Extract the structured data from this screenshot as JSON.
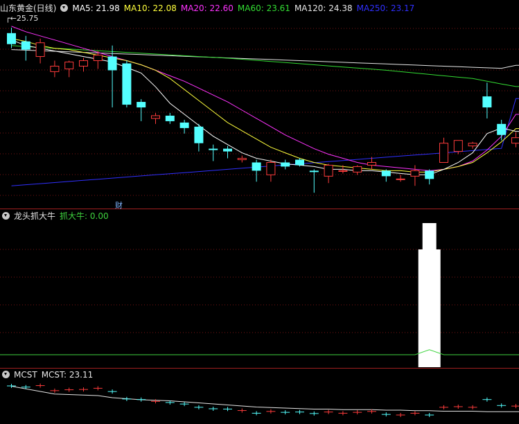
{
  "main_panel": {
    "title": "山东黄金(日线)",
    "ma": [
      {
        "label": "MA5: 21.98",
        "color": "#ffffff"
      },
      {
        "label": "MA10: 22.08",
        "color": "#ffff3c"
      },
      {
        "label": "MA20: 22.60",
        "color": "#ff33ff"
      },
      {
        "label": "MA60: 23.61",
        "color": "#33dd33"
      },
      {
        "label": "MA120: 24.38",
        "color": "#e6e6e6"
      },
      {
        "label": "MA250: 23.17",
        "color": "#3030ff"
      }
    ],
    "high_marker": "25.75",
    "event_marker": "财"
  },
  "sub_panel1": {
    "title": "龙头抓大牛",
    "series_label": "抓大牛: 0.00"
  },
  "sub_panel2": {
    "title": "MCST",
    "value_label": "MCST: 23.11"
  },
  "colors": {
    "up": "#ff3c3c",
    "down": "#54ffff",
    "grid": "#7a1515",
    "ma5": "#ffffff",
    "ma10": "#ffff3c",
    "ma20": "#ff33ff",
    "ma60": "#33dd33",
    "ma120": "#e6e6e6",
    "ma250": "#3030ff",
    "signal_bar": "#ffffff",
    "signal_line": "#3fd43f"
  },
  "chart_data": {
    "type": "candlestick",
    "candles": [
      {
        "o": 25.55,
        "h": 25.75,
        "l": 25.0,
        "c": 25.15
      },
      {
        "o": 25.25,
        "h": 25.45,
        "l": 24.55,
        "c": 24.95
      },
      {
        "o": 24.7,
        "h": 25.35,
        "l": 24.45,
        "c": 25.2
      },
      {
        "o": 24.15,
        "h": 24.55,
        "l": 23.95,
        "c": 24.35
      },
      {
        "o": 24.25,
        "h": 24.55,
        "l": 23.95,
        "c": 24.5
      },
      {
        "o": 24.35,
        "h": 24.65,
        "l": 24.15,
        "c": 24.55
      },
      {
        "o": 24.55,
        "h": 24.9,
        "l": 24.25,
        "c": 24.75
      },
      {
        "o": 24.7,
        "h": 25.1,
        "l": 22.85,
        "c": 24.2
      },
      {
        "o": 24.45,
        "h": 24.55,
        "l": 22.85,
        "c": 22.95
      },
      {
        "o": 23.05,
        "h": 23.15,
        "l": 22.35,
        "c": 22.85
      },
      {
        "o": 22.45,
        "h": 22.65,
        "l": 22.25,
        "c": 22.55
      },
      {
        "o": 22.55,
        "h": 22.65,
        "l": 22.25,
        "c": 22.35
      },
      {
        "o": 22.3,
        "h": 22.4,
        "l": 21.9,
        "c": 22.1
      },
      {
        "o": 22.15,
        "h": 22.25,
        "l": 21.25,
        "c": 21.55
      },
      {
        "o": 21.35,
        "h": 21.5,
        "l": 20.9,
        "c": 21.3
      },
      {
        "o": 21.35,
        "h": 21.45,
        "l": 21.0,
        "c": 21.25
      },
      {
        "o": 20.95,
        "h": 21.1,
        "l": 20.85,
        "c": 21.0
      },
      {
        "o": 20.85,
        "h": 20.95,
        "l": 20.15,
        "c": 20.55
      },
      {
        "o": 20.4,
        "h": 20.95,
        "l": 20.15,
        "c": 20.85
      },
      {
        "o": 20.85,
        "h": 20.95,
        "l": 20.6,
        "c": 20.7
      },
      {
        "o": 20.95,
        "h": 21.0,
        "l": 20.7,
        "c": 20.75
      },
      {
        "o": 20.55,
        "h": 20.6,
        "l": 19.75,
        "c": 20.5
      },
      {
        "o": 20.35,
        "h": 20.8,
        "l": 20.1,
        "c": 20.75
      },
      {
        "o": 20.55,
        "h": 20.75,
        "l": 20.45,
        "c": 20.55
      },
      {
        "o": 20.5,
        "h": 20.75,
        "l": 20.4,
        "c": 20.7
      },
      {
        "o": 20.75,
        "h": 21.05,
        "l": 20.6,
        "c": 20.85
      },
      {
        "o": 20.55,
        "h": 20.6,
        "l": 20.15,
        "c": 20.35
      },
      {
        "o": 20.25,
        "h": 20.4,
        "l": 20.15,
        "c": 20.25
      },
      {
        "o": 20.35,
        "h": 20.75,
        "l": 20.0,
        "c": 20.55
      },
      {
        "o": 20.55,
        "h": 20.6,
        "l": 20.05,
        "c": 20.25
      },
      {
        "o": 20.85,
        "h": 21.75,
        "l": 20.85,
        "c": 21.55
      },
      {
        "o": 21.25,
        "h": 21.65,
        "l": 21.15,
        "c": 21.65
      },
      {
        "o": 21.45,
        "h": 21.6,
        "l": 21.35,
        "c": 21.55
      },
      {
        "o": 23.25,
        "h": 23.75,
        "l": 22.45,
        "c": 22.85
      },
      {
        "o": 22.25,
        "h": 22.4,
        "l": 21.65,
        "c": 21.85
      },
      {
        "o": 21.55,
        "h": 21.95,
        "l": 21.4,
        "c": 21.75
      }
    ],
    "ma5": [
      25.3,
      25.1,
      25.0,
      24.9,
      24.8,
      24.7,
      24.6,
      24.5,
      24.3,
      24.1,
      23.6,
      23.0,
      22.6,
      22.2,
      21.8,
      21.5,
      21.2,
      21.0,
      20.9,
      20.8,
      20.75,
      20.7,
      20.6,
      20.6,
      20.55,
      20.55,
      20.5,
      20.45,
      20.4,
      20.4,
      20.6,
      20.85,
      21.2,
      21.9,
      22.1,
      21.98
    ],
    "ma10": [
      25.35,
      25.25,
      25.1,
      25.0,
      24.95,
      24.85,
      24.75,
      24.65,
      24.55,
      24.4,
      24.2,
      23.9,
      23.5,
      23.1,
      22.7,
      22.3,
      22.0,
      21.7,
      21.4,
      21.2,
      21.0,
      20.85,
      20.75,
      20.7,
      20.65,
      20.6,
      20.55,
      20.55,
      20.5,
      20.5,
      20.6,
      20.7,
      20.85,
      21.2,
      21.6,
      22.08
    ],
    "ma20": [
      25.8,
      25.6,
      25.45,
      25.3,
      25.15,
      25.0,
      24.85,
      24.7,
      24.55,
      24.4,
      24.2,
      24.0,
      23.8,
      23.55,
      23.3,
      23.05,
      22.75,
      22.45,
      22.15,
      21.85,
      21.6,
      21.35,
      21.15,
      21.0,
      20.85,
      20.75,
      20.7,
      20.65,
      20.6,
      20.55,
      20.6,
      20.7,
      20.9,
      21.3,
      21.8,
      22.6
    ],
    "ma60": [
      25.1,
      25.06,
      25.03,
      25.0,
      24.97,
      24.94,
      24.91,
      24.88,
      24.85,
      24.82,
      24.79,
      24.76,
      24.73,
      24.7,
      24.67,
      24.64,
      24.6,
      24.56,
      24.52,
      24.48,
      24.44,
      24.4,
      24.36,
      24.32,
      24.28,
      24.24,
      24.2,
      24.15,
      24.1,
      24.05,
      24.0,
      23.95,
      23.9,
      23.8,
      23.7,
      23.61
    ],
    "ma120": [
      24.95,
      24.93,
      24.91,
      24.89,
      24.87,
      24.85,
      24.83,
      24.81,
      24.79,
      24.77,
      24.75,
      24.73,
      24.71,
      24.69,
      24.67,
      24.65,
      24.63,
      24.61,
      24.59,
      24.57,
      24.55,
      24.53,
      24.51,
      24.49,
      24.47,
      24.45,
      24.43,
      24.41,
      24.39,
      24.37,
      24.35,
      24.33,
      24.31,
      24.29,
      24.27,
      24.38
    ],
    "ma250": [
      20.0,
      20.04,
      20.08,
      20.12,
      20.16,
      20.2,
      20.24,
      20.28,
      20.32,
      20.36,
      20.4,
      20.44,
      20.48,
      20.52,
      20.56,
      20.6,
      20.64,
      20.68,
      20.72,
      20.76,
      20.8,
      20.84,
      20.88,
      20.92,
      20.96,
      21.0,
      21.04,
      21.08,
      21.12,
      21.16,
      21.2,
      21.24,
      21.28,
      21.32,
      21.36,
      23.17
    ],
    "ylim": [
      19.2,
      26.2
    ],
    "signal": {
      "bar_index": 29,
      "value_max": 1.0
    },
    "signal_line": [
      0,
      0,
      0,
      0,
      0,
      0,
      0,
      0,
      0,
      0,
      0,
      0,
      0,
      0,
      0,
      0,
      0,
      0,
      0,
      0,
      0,
      0,
      0,
      0,
      0,
      0,
      0,
      0,
      0,
      0.12,
      0,
      0,
      0,
      0,
      0,
      0
    ],
    "mcst": [
      23.6,
      23.55,
      23.5,
      23.45,
      23.44,
      23.43,
      23.42,
      23.38,
      23.36,
      23.34,
      23.33,
      23.32,
      23.3,
      23.28,
      23.26,
      23.24,
      23.22,
      23.2,
      23.19,
      23.18,
      23.17,
      23.16,
      23.16,
      23.15,
      23.15,
      23.15,
      23.14,
      23.14,
      23.13,
      23.13,
      23.12,
      23.12,
      23.12,
      23.11,
      23.11,
      23.11
    ]
  }
}
